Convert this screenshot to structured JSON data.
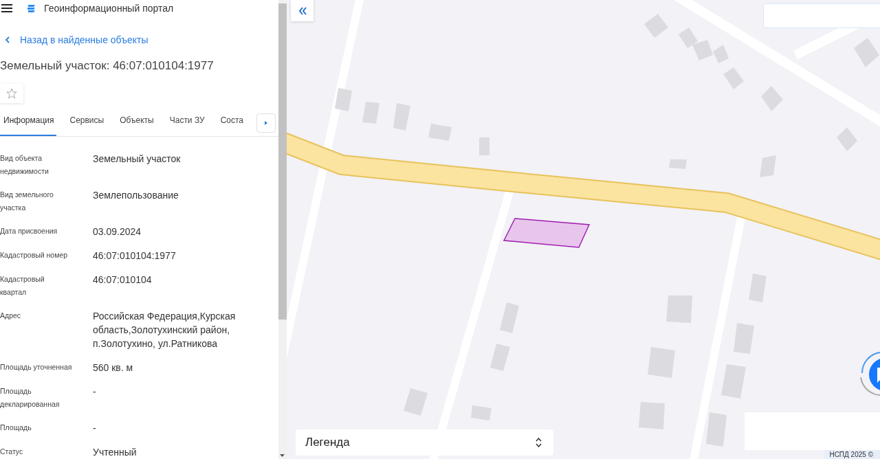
{
  "header": {
    "title": "Геоинформационный портал"
  },
  "back_link": "Назад в найденные объекты",
  "heading": "Земельный участок: 46:07:010104:1977",
  "favorite": {
    "on": false
  },
  "tabs": [
    {
      "label": "Информация",
      "selected": true
    },
    {
      "label": "Сервисы",
      "selected": false
    },
    {
      "label": "Объекты",
      "selected": false
    },
    {
      "label": "Части ЗУ",
      "selected": false
    },
    {
      "label": "Соста",
      "selected": false
    }
  ],
  "fields": [
    {
      "label": "Вид объекта недвижимости",
      "value": "Земельный участок"
    },
    {
      "label": "Вид земельного участка",
      "value": "Землепользование"
    },
    {
      "label": "Дата присвоения",
      "value": "03.09.2024"
    },
    {
      "label": "Кадастровый номер",
      "value": "46:07:010104:1977"
    },
    {
      "label": "Кадастровый квартал",
      "value": "46:07:010104"
    },
    {
      "label": "Адрес",
      "value": "Российская Федерация,Курская область,Золотухинский район, п.Золотухино, ул.Ратникова"
    },
    {
      "label": "Площадь уточненная",
      "value": "560 кв. м"
    },
    {
      "label": "Площадь декларированная",
      "value": "-"
    },
    {
      "label": "Площадь",
      "value": "-"
    },
    {
      "label": "Статус",
      "value": "Учтенный"
    }
  ],
  "map": {
    "kind": "picture",
    "legend": "Легенда",
    "attribution": "НСПД 2025 ©"
  }
}
